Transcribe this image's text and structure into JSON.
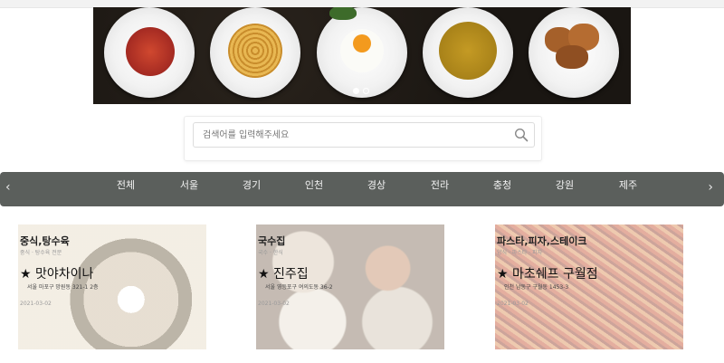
{
  "carousel": {
    "plates": [
      {
        "name": "plate-jjambbong",
        "food_color": "#b8352a"
      },
      {
        "name": "plate-pasta",
        "food_color": "#d9a441"
      },
      {
        "name": "plate-fried-egg",
        "food_color": "#ffffff"
      },
      {
        "name": "plate-pumpkin-soup",
        "food_color": "#b48a1c"
      },
      {
        "name": "plate-croissant",
        "food_color": "#9b5a2a"
      }
    ],
    "active_slide": 1,
    "slide_count": 2
  },
  "search": {
    "placeholder": "검색어를 입력해주세요",
    "value": "",
    "icon": "search-icon"
  },
  "nav": {
    "prev_arrow": "‹",
    "next_arrow": "›",
    "regions": [
      "전체",
      "서울",
      "경기",
      "인천",
      "경상",
      "전라",
      "충청",
      "강원",
      "제주"
    ]
  },
  "cards": [
    {
      "category": "중식,탕수육",
      "subtitle": "중식 · 탕수육 전문",
      "name": "★ 맛야차이나",
      "address": "서울 마포구 망원동 321-1 2층",
      "date": "2021-03-02",
      "image_color": "#c9b79a"
    },
    {
      "category": "국수집",
      "subtitle": "국수 · 한식",
      "name": "★ 진주집",
      "address": "서울 영등포구 여의도동 36-2",
      "date": "2021-03-02",
      "image_color": "#a8917a"
    },
    {
      "category": "파스타,피자,스테이크",
      "subtitle": "양식 · 파스타 · 피자",
      "name": "★ 마초쉐프 구월점",
      "address": "인천 남동구 구월동 1453-3",
      "date": "2021-03-02",
      "image_color": "#c96a43"
    }
  ]
}
